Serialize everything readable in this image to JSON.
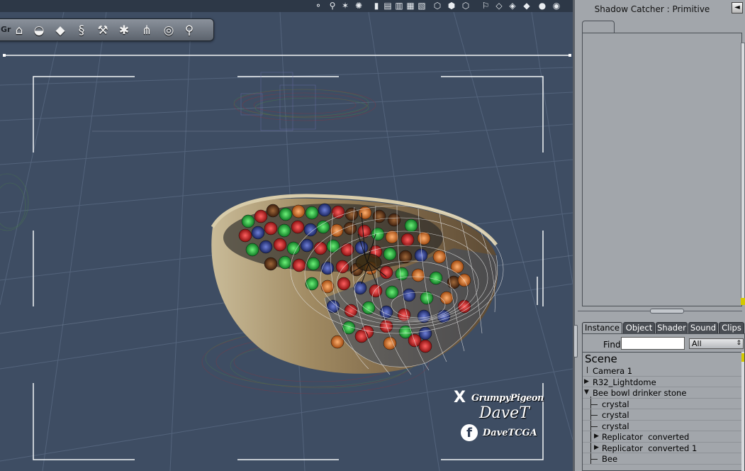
{
  "viewport": {
    "top_toolbar_icons": [
      "node-icon",
      "joint-icon",
      "figure-icon",
      "target-icon",
      "view-single-icon",
      "view-2-icon",
      "view-3-icon",
      "view-4-icon",
      "view-5-icon",
      "cube-wire-icon",
      "cube-hidden-icon",
      "cube-shaded-icon",
      "bone-icon",
      "box-wire-icon",
      "box-icon",
      "cube-solid-icon",
      "sphere-icon",
      "sphere-lit-icon"
    ],
    "tool_strip": {
      "prefix": "Gr",
      "tools": [
        "home-icon",
        "bowl-icon",
        "bucket-icon",
        "spring-icon",
        "hammer-icon",
        "camera-icon",
        "hierarchy-icon",
        "target-icon",
        "bone-tool-icon"
      ]
    },
    "watermark": {
      "x_glyph": "X",
      "handle": "GrumpyPigeon",
      "signature": "DaveT",
      "fb_glyph": "f",
      "fb_handle": "DaveTCGA"
    }
  },
  "properties_panel": {
    "title": "Shadow Catcher : Primitive",
    "collapse_glyph": "◄"
  },
  "instance_panel": {
    "tabs": [
      "Instance",
      "Object",
      "Shader",
      "Sound",
      "Clips"
    ],
    "active_tab": "Instance",
    "find_label": "Find:",
    "find_value": "",
    "filter_value": "All",
    "filter_arrow": "⇕"
  },
  "scene_tree": {
    "root_label": "Scene",
    "items": [
      {
        "label": "Camera 1",
        "twisty": ""
      },
      {
        "label": "R32_Lightdome",
        "twisty": "▶"
      },
      {
        "label": "Bee bowl drinker stone",
        "twisty": "▼"
      },
      {
        "label": "crystal",
        "twisty": ""
      },
      {
        "label": "crystal",
        "twisty": ""
      },
      {
        "label": "crystal",
        "twisty": ""
      },
      {
        "label": "Replicator  converted",
        "twisty": "▶"
      },
      {
        "label": "Replicator  converted 1",
        "twisty": "▶"
      },
      {
        "label": "Bee",
        "twisty": ""
      }
    ]
  },
  "colors": {
    "viewport_bg": "#3e4d63",
    "panel_bg": "#a2a6ab",
    "marble_red": "#c81e1e",
    "marble_green": "#1fa83a",
    "marble_blue": "#2a3b8c",
    "marble_orange": "#d9701e",
    "marble_brown": "#6b3a1a"
  }
}
